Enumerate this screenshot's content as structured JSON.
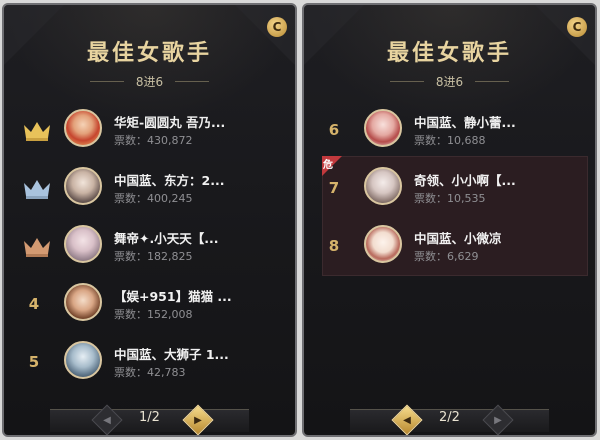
{
  "left_panel": {
    "title": "最佳女歌手",
    "subtitle": "8进6",
    "badge": "C",
    "entries": [
      {
        "rank": "",
        "crown": "gold",
        "name": "华矩-圆圆丸 吾乃...",
        "votes": "票数：430,872"
      },
      {
        "rank": "",
        "crown": "silver",
        "name": "中国蓝、东方：2...",
        "votes": "票数：400,245"
      },
      {
        "rank": "",
        "crown": "bronze",
        "name": "舞帝✦.小天天【...",
        "votes": "票数：182,825"
      },
      {
        "rank": "4",
        "crown": "",
        "name": "【娱+951】猫猫 ...",
        "votes": "票数：152,008"
      },
      {
        "rank": "5",
        "crown": "",
        "name": "中国蓝、大狮子 1...",
        "votes": "票数：42,783"
      }
    ],
    "page": "1/2"
  },
  "right_panel": {
    "title": "最佳女歌手",
    "subtitle": "8进6",
    "badge": "C",
    "danger_label": "危",
    "entries": [
      {
        "rank": "6",
        "name": "中国蓝、静小蕾...",
        "votes": "票数：10,688"
      },
      {
        "rank": "7",
        "name": "奇领、小小啊【...",
        "votes": "票数：10,535"
      },
      {
        "rank": "8",
        "name": "中国蓝、小微凉",
        "votes": "票数：6,629"
      }
    ],
    "page": "2/2"
  },
  "colors": {
    "gold": "#e8d4a0",
    "crown_gold": "#e8c25a",
    "crown_silver": "#a9c3de",
    "crown_bronze": "#d39a72",
    "danger": "#c1393d"
  }
}
